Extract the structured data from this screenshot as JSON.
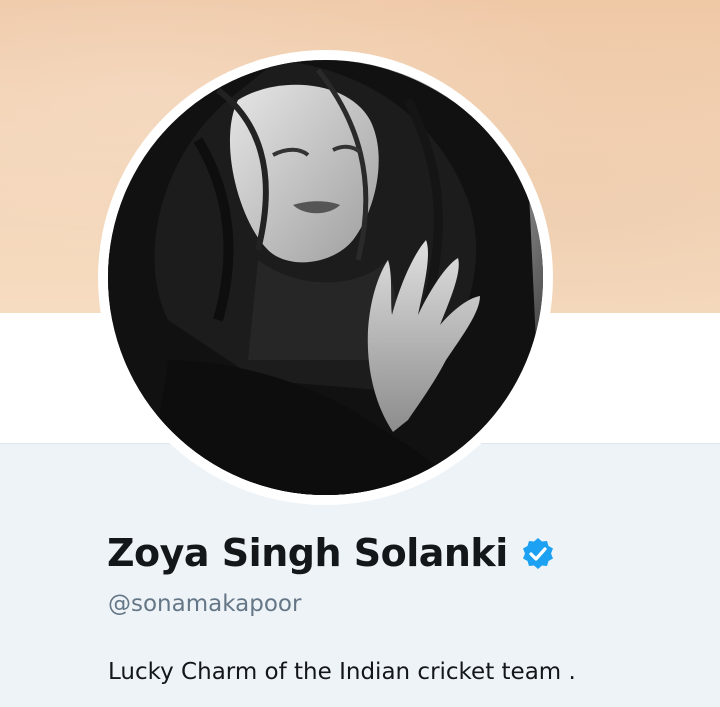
{
  "profile": {
    "display_name": "Zoya Singh Solanki",
    "handle": "@sonamakapoor",
    "bio": "Lucky Charm of the Indian cricket team .",
    "verified": true,
    "verified_icon": "verified-badge-icon"
  },
  "images": {
    "banner": "header-banner-image",
    "avatar": "profile-avatar-photo"
  },
  "colors": {
    "banner": "#f3d3b5",
    "profile_background": "#eef3f8",
    "name_text": "#14171a",
    "handle_text": "#657786",
    "verified_blue": "#1da1f2"
  }
}
